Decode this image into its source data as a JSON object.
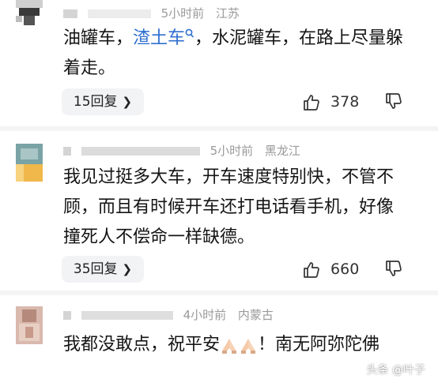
{
  "comments": [
    {
      "time": "5小时前",
      "location": "江苏",
      "text_before": "油罐车，",
      "link": "渣土车",
      "link_icon": "search-icon",
      "text_after": "，水泥罐车，在路上尽量躲着走。",
      "replies": "15回复",
      "likes": "378"
    },
    {
      "time": "5小时前",
      "location": "黑龙江",
      "text": "我见过挺多大车，开车速度特别快，不管不顾，而且有时候开车还打电话看手机，好像撞死人不偿命一样缺德。",
      "replies": "35回复",
      "likes": "660"
    },
    {
      "time": "4小时前",
      "location": "内蒙古",
      "text_before": "我都没敢点，祝平安",
      "emoji": "praying-hands-icon",
      "text_after": "！南无阿弥陀佛"
    }
  ],
  "watermark": "头条 @叶子"
}
